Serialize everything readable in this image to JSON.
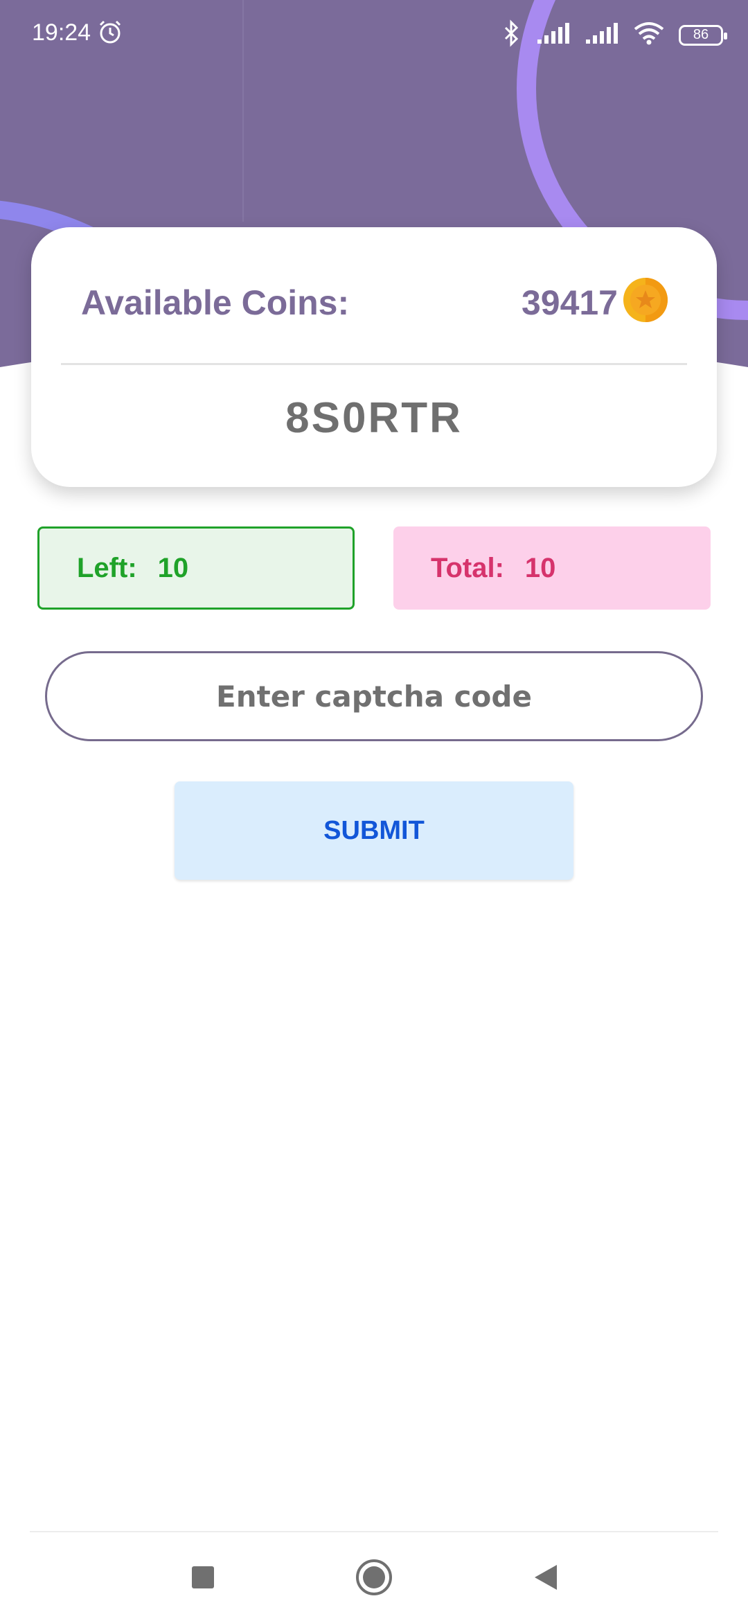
{
  "status_bar": {
    "time": "19:24",
    "battery": "86",
    "icons": [
      "alarm-icon",
      "bluetooth-icon",
      "signal-icon",
      "signal-icon",
      "wifi-icon",
      "battery-icon"
    ]
  },
  "colors": {
    "header": "#7b6b9a",
    "accent_ring": "#a88af0",
    "left_text": "#1fa229",
    "total_text": "#d6336c",
    "submit_text": "#1256d8"
  },
  "card": {
    "coins_label": "Available Coins:",
    "coins_value": "39417",
    "captcha": "8S0RTR"
  },
  "stats": {
    "left_label": "Left:",
    "left_value": "10",
    "total_label": "Total:",
    "total_value": "10"
  },
  "input": {
    "placeholder": "Enter captcha code",
    "value": ""
  },
  "submit": {
    "label": "SUBMIT"
  },
  "navigation": [
    "recent-apps",
    "home",
    "back"
  ]
}
